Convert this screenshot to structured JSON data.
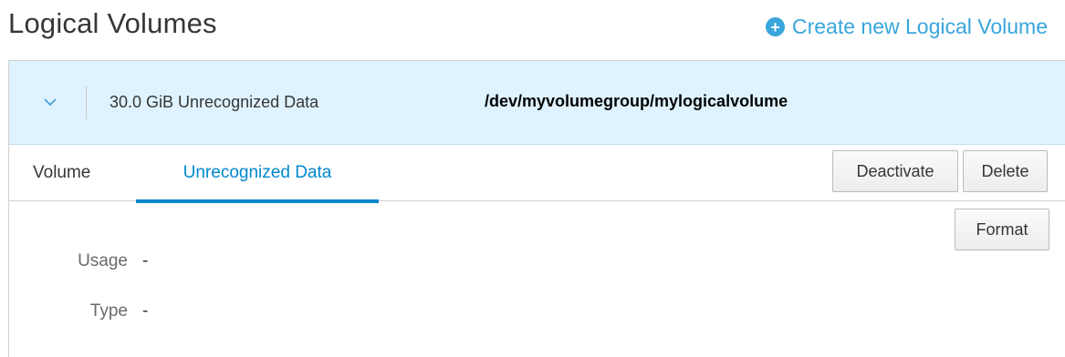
{
  "header": {
    "title": "Logical Volumes",
    "create_link": "Create new Logical Volume",
    "create_icon": "plus-circle-icon"
  },
  "volume_row": {
    "expand_icon": "chevron-down-icon",
    "size_label": "30.0 GiB Unrecognized Data",
    "device_path": "/dev/myvolumegroup/mylogicalvolume"
  },
  "tabs": [
    {
      "label": "Volume",
      "active": false
    },
    {
      "label": "Unrecognized Data",
      "active": true
    }
  ],
  "actions": {
    "deactivate": "Deactivate",
    "delete": "Delete",
    "format": "Format"
  },
  "details": {
    "usage_label": "Usage",
    "usage_value": "-",
    "type_label": "Type",
    "type_value": "-"
  },
  "colors": {
    "accent": "#0088ce",
    "link": "#39a5dc",
    "row_highlight": "#def3ff"
  }
}
